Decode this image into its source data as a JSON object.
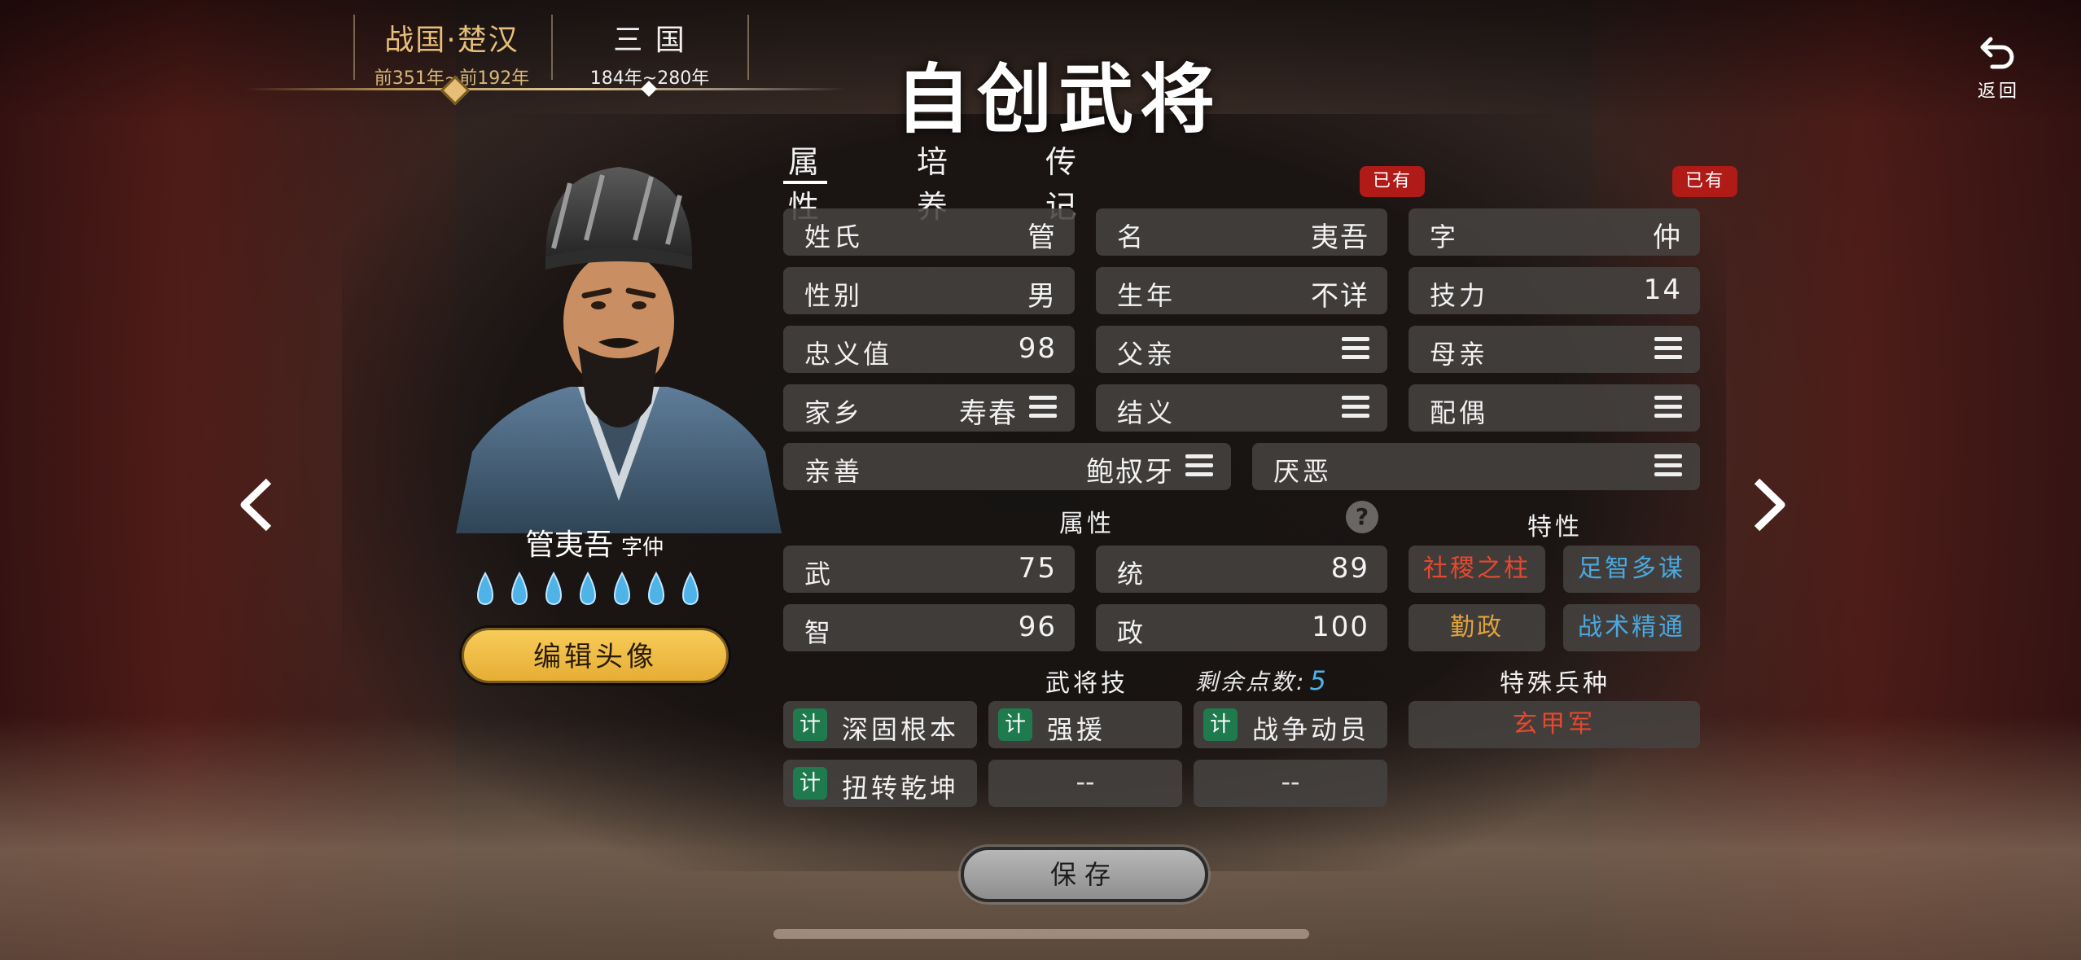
{
  "eras": [
    {
      "name": "战国·楚汉",
      "years": "前351年~前192年",
      "active": true
    },
    {
      "name": "三 国",
      "years": "184年~280年",
      "active": false
    }
  ],
  "title": "自创武将",
  "back_label": "返回",
  "hero": {
    "name": "管夷吾",
    "courtesy": "字仲",
    "flames": 7,
    "edit_avatar_label": "编辑头像"
  },
  "tabs": [
    "属性",
    "培养",
    "传记"
  ],
  "owned_badge": "已有",
  "fields": {
    "surname": {
      "label": "姓氏",
      "value": "管"
    },
    "given": {
      "label": "名",
      "value": "夷吾"
    },
    "courtesy": {
      "label": "字",
      "value": "仲"
    },
    "gender": {
      "label": "性别",
      "value": "男"
    },
    "birth": {
      "label": "生年",
      "value": "不详"
    },
    "skill_power": {
      "label": "技力",
      "value": "14"
    },
    "loyalty": {
      "label": "忠义值",
      "value": "98"
    },
    "father": {
      "label": "父亲",
      "value": ""
    },
    "mother": {
      "label": "母亲",
      "value": ""
    },
    "hometown": {
      "label": "家乡",
      "value": "寿春"
    },
    "sworn": {
      "label": "结义",
      "value": ""
    },
    "spouse": {
      "label": "配偶",
      "value": ""
    },
    "friendly": {
      "label": "亲善",
      "value": "鲍叔牙"
    },
    "hated": {
      "label": "厌恶",
      "value": ""
    }
  },
  "attributes_heading": "属性",
  "help_symbol": "?",
  "traits_heading": "特性",
  "attributes": {
    "war": {
      "label": "武",
      "value": "75"
    },
    "lead": {
      "label": "统",
      "value": "89"
    },
    "intel": {
      "label": "智",
      "value": "96"
    },
    "politics": {
      "label": "政",
      "value": "100"
    }
  },
  "traits": [
    {
      "name": "社稷之柱",
      "color": "#e5492d"
    },
    {
      "name": "足智多谋",
      "color": "#4aa8e0"
    },
    {
      "name": "勤政",
      "color": "#e0a33a"
    },
    {
      "name": "战术精通",
      "color": "#4aa8e0"
    }
  ],
  "skills_heading": "武将技",
  "remaining_label": "剩余点数:",
  "remaining_points": "5",
  "skills": [
    {
      "tag": "计",
      "name": "深固根本"
    },
    {
      "tag": "计",
      "name": "强援"
    },
    {
      "tag": "计",
      "name": "战争动员"
    },
    {
      "tag": "计",
      "name": "扭转乾坤"
    },
    {
      "tag": "",
      "name": "--"
    },
    {
      "tag": "",
      "name": "--"
    }
  ],
  "special_troop_heading": "特殊兵种",
  "special_troop": "玄甲军",
  "save_label": "保存",
  "colors": {
    "accent_gold": "#e6be78",
    "badge_red": "#b01a17",
    "skill_green": "#1f7a4e",
    "flame_blue": "#4fb3e8"
  }
}
